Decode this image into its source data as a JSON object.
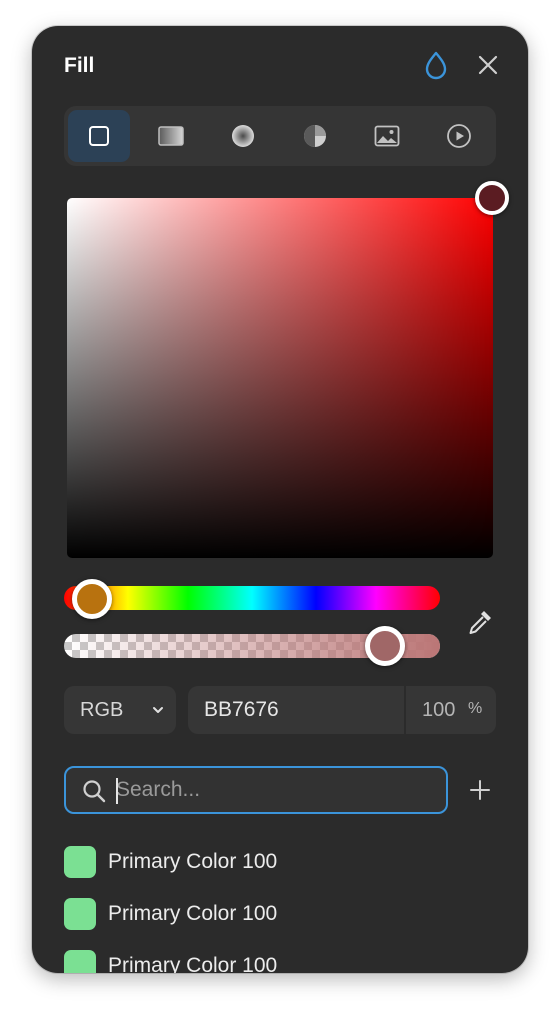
{
  "header": {
    "title": "Fill",
    "drop_icon": "water-drop-icon",
    "close_icon": "close-icon"
  },
  "fill_types": [
    {
      "name": "solid",
      "icon": "square-icon",
      "active": true
    },
    {
      "name": "linear-gradient",
      "icon": "linear-gradient-icon",
      "active": false
    },
    {
      "name": "radial-gradient",
      "icon": "radial-gradient-icon",
      "active": false
    },
    {
      "name": "angular-gradient",
      "icon": "angular-gradient-icon",
      "active": false
    },
    {
      "name": "image",
      "icon": "image-icon",
      "active": false
    },
    {
      "name": "video",
      "icon": "play-icon",
      "active": false
    }
  ],
  "picker": {
    "hue_color": "#ff0000",
    "sv_thumb_color": "#5b1c22",
    "hue_thumb_color": "#b8720f",
    "alpha_thumb_color": "#a06767",
    "accent": "#3b94da"
  },
  "color_input": {
    "mode": "RGB",
    "hex": "BB7676",
    "opacity": "100",
    "opacity_unit": "%"
  },
  "search": {
    "placeholder": "Search...",
    "value": ""
  },
  "swatches": [
    {
      "label": "Primary Color 100",
      "color": "#7be093"
    },
    {
      "label": "Primary Color 100",
      "color": "#7be093"
    },
    {
      "label": "Primary Color 100",
      "color": "#7be093"
    }
  ]
}
